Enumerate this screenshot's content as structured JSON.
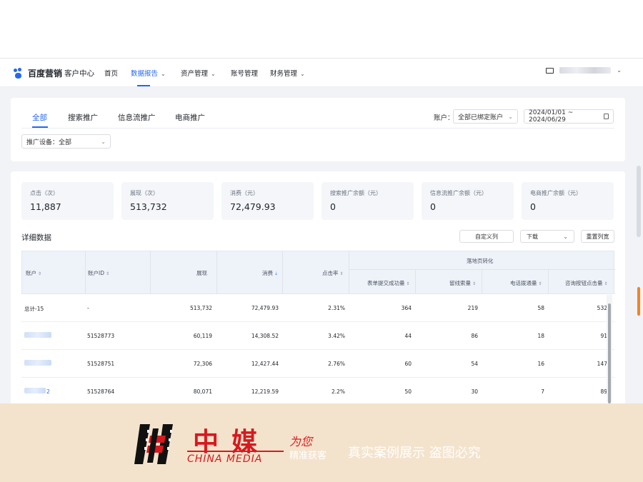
{
  "header": {
    "brand": "百度营销",
    "sub": "客户中心",
    "nav": [
      {
        "label": "首页",
        "has_menu": false
      },
      {
        "label": "数据报告",
        "has_menu": true,
        "active": true
      },
      {
        "label": "资产管理",
        "has_menu": true
      },
      {
        "label": "账号管理",
        "has_menu": false
      },
      {
        "label": "财务管理",
        "has_menu": true
      }
    ],
    "icons": [
      "mail-icon",
      "user-icon"
    ]
  },
  "filters": {
    "tabs": [
      "全部",
      "搜索推广",
      "信息流推广",
      "电商推广"
    ],
    "active_tab": "全部",
    "account_label": "账户：",
    "account_value": "全部已绑定账户",
    "date_range": "2024/01/01 ~ 2024/06/29",
    "device_filter": "推广设备：全部"
  },
  "stats": [
    {
      "label": "点击（次）",
      "value": "11,887"
    },
    {
      "label": "展现（次）",
      "value": "513,732"
    },
    {
      "label": "消费（元）",
      "value": "72,479.93"
    },
    {
      "label": "搜索推广余额（元）",
      "value": "0"
    },
    {
      "label": "信息流推广余额（元）",
      "value": "0"
    },
    {
      "label": "电商推广余额（元）",
      "value": "0"
    }
  ],
  "detail": {
    "title": "详细数据",
    "custom_columns": "自定义列",
    "download": "下载",
    "reset_columns": "重置列宽"
  },
  "table": {
    "group_header": "落地页转化",
    "columns": [
      "账户",
      "账户ID",
      "展现",
      "消费",
      "点击率",
      "表单提交成功量",
      "留线索量",
      "电话拨通量",
      "咨询按钮点击量"
    ],
    "rows": [
      {
        "account": "总计-15",
        "id": "-",
        "impressions": "513,732",
        "cost": "72,479.93",
        "ctr": "2.31%",
        "form": "364",
        "leads": "219",
        "calls": "58",
        "consult": "532"
      },
      {
        "account": "",
        "id": "51528773",
        "impressions": "60,119",
        "cost": "14,308.52",
        "ctr": "3.42%",
        "form": "44",
        "leads": "86",
        "calls": "18",
        "consult": "91"
      },
      {
        "account": "",
        "id": "51528751",
        "impressions": "72,306",
        "cost": "12,427.44",
        "ctr": "2.76%",
        "form": "60",
        "leads": "54",
        "calls": "16",
        "consult": "147"
      },
      {
        "account": "2",
        "id": "51528764",
        "impressions": "80,071",
        "cost": "12,219.59",
        "ctr": "2.2%",
        "form": "50",
        "leads": "30",
        "calls": "7",
        "consult": "89"
      }
    ]
  },
  "watermark": {
    "cn": "中媒",
    "en": "CHINA MEDIA",
    "for": "为您",
    "slogan1": "精准获客",
    "slogan2": "真实案例展示  盗图必究",
    "color": "#d7191f"
  },
  "colors": {
    "accent": "#2468f2"
  }
}
